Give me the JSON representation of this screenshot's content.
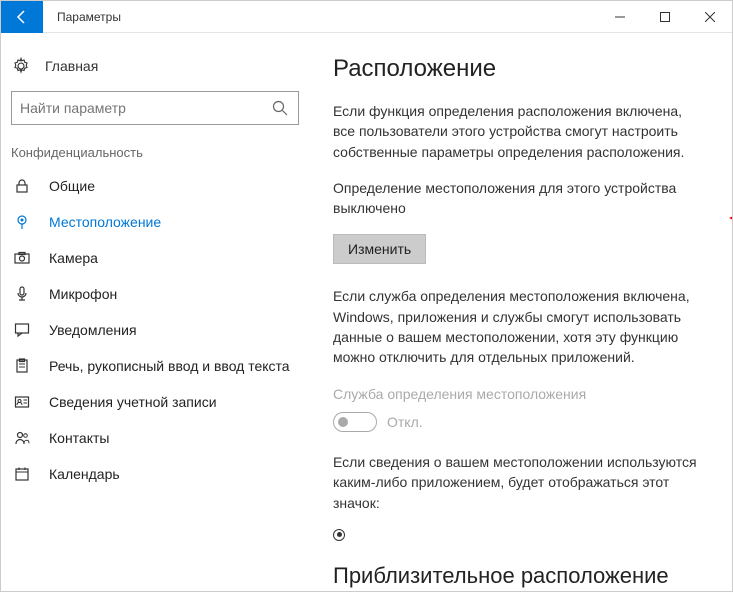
{
  "titlebar": {
    "title": "Параметры"
  },
  "sidebar": {
    "home": "Главная",
    "search_placeholder": "Найти параметр",
    "category": "Конфиденциальность",
    "items": [
      {
        "label": "Общие"
      },
      {
        "label": "Местоположение"
      },
      {
        "label": "Камера"
      },
      {
        "label": "Микрофон"
      },
      {
        "label": "Уведомления"
      },
      {
        "label": "Речь, рукописный ввод и ввод текста"
      },
      {
        "label": "Сведения учетной записи"
      },
      {
        "label": "Контакты"
      },
      {
        "label": "Календарь"
      }
    ]
  },
  "main": {
    "heading": "Расположение",
    "para1": "Если функция определения расположения включена, все пользователи этого устройства смогут настроить собственные параметры определения расположения.",
    "status": "Определение местоположения для этого устройства выключено",
    "change_btn": "Изменить",
    "para2": "Если служба определения местоположения включена, Windows, приложения и службы смогут использовать данные о вашем местоположении, хотя эту функцию можно отключить для отдельных приложений.",
    "service_label": "Служба определения местоположения",
    "toggle_state": "Откл.",
    "para3": "Если сведения о вашем местоположении используются каким-либо приложением, будет отображаться этот значок:",
    "heading2": "Приблизительное расположение"
  }
}
